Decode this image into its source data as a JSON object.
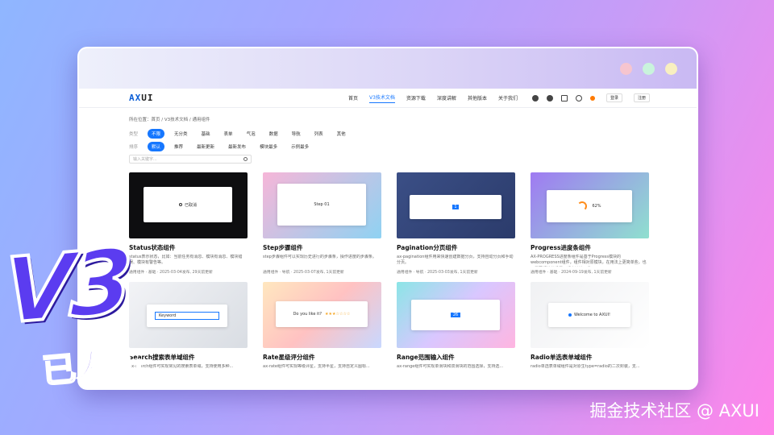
{
  "nav": {
    "logo_a": "AX",
    "logo_b": "UI",
    "items": [
      "首页",
      "V3技术文档",
      "资源下载",
      "深度讲解",
      "其他版本",
      "关于我们"
    ],
    "login": "登录",
    "register": "注册"
  },
  "breadcrumb": "所在位置：首页 / V3技术文档 / 通用组件",
  "filters": {
    "type_label": "类型",
    "types": [
      "不限",
      "无分类",
      "基础",
      "表单",
      "气泡",
      "数据",
      "导航",
      "列表",
      "其他"
    ],
    "sort_label": "排序",
    "sorts": [
      "默认",
      "推荐",
      "最新更新",
      "最新发布",
      "模块最多",
      "示例最多"
    ]
  },
  "search": {
    "placeholder": "输入关键字..."
  },
  "cards": [
    {
      "title": "Status状态组件",
      "desc": "status表示状态，比如：当前任务有消息、模块有消息、模块错误、模块有警告等。",
      "cat": "通用组件",
      "tag": "基础",
      "date": "2025-03-04发布, 29天前更新",
      "thumb_text": "已取消"
    },
    {
      "title": "Step步骤组件",
      "desc": "step步骤组件可以实现历史进行的步骤条，操作进度的步骤条。",
      "cat": "通用组件",
      "tag": "导航",
      "date": "2025-03-07发布, 1天前更新",
      "thumb_text": "Step 01"
    },
    {
      "title": "Pagination分页组件",
      "desc": "ax-pagination组件用来快速创建数据分页，支持自动分页和手动分页。",
      "cat": "通用组件",
      "tag": "导航",
      "date": "2025-03-03发布, 1天前更新",
      "thumb_text": "1"
    },
    {
      "title": "Progress进度条组件",
      "desc": "AX-PROGRESS进度条组件是基于Progress模块的webcomponent组件，组件相对原模块，在用法上更简单些，也不需要额外的设置，适合敏捷开发。",
      "cat": "通用组件",
      "tag": "基础",
      "date": "2024-09-19发布, 1天前更新",
      "thumb_text": "62%"
    },
    {
      "title": "Search搜索表单域组件",
      "desc": "ax-search组件可实现常见的搜索表单域，支持使用多种...",
      "thumb_text": "Keyword"
    },
    {
      "title": "Rate星级评分组件",
      "desc": "ax-rate组件可实现等级评星，支持半星，支持自定义图标...",
      "thumb_text": "Do you like it?"
    },
    {
      "title": "Range范围输入组件",
      "desc": "ax-range组件可实现单滑块和双滑块的范围选择，支持选...",
      "thumb_text": "26"
    },
    {
      "title": "Radio单选表单域组件",
      "desc": "radio单选表单域组件是对原生type=radio的二次封装，支...",
      "thumb_text": "Welcome to AXUI!"
    }
  ],
  "overlay": {
    "v3": "V3",
    "released": "已发布",
    "watermark": "掘金技术社区 @ AXUI"
  }
}
